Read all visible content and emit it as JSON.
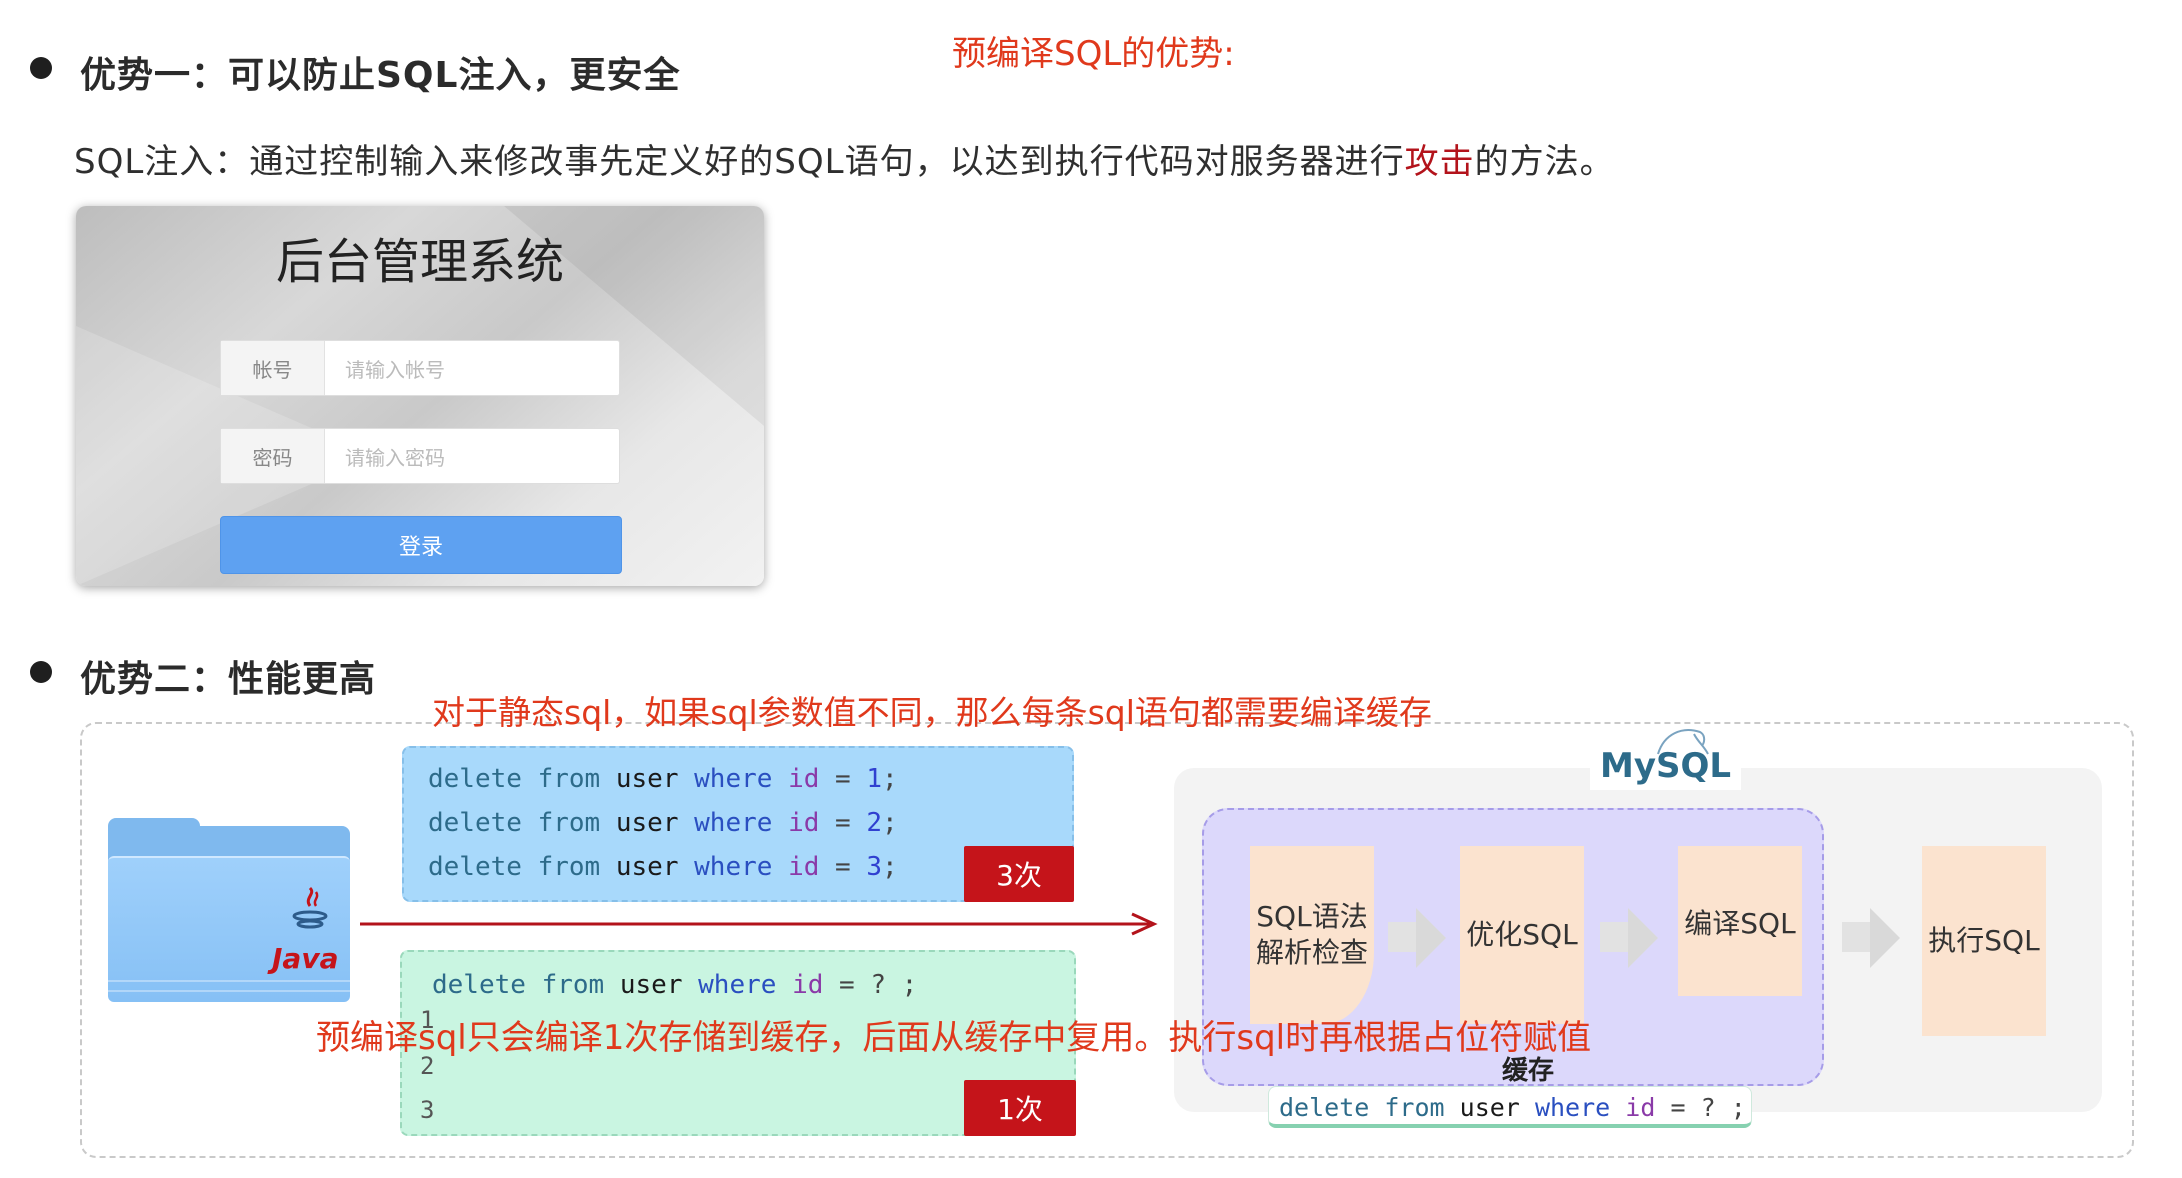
{
  "title_annotation": "预编译SQL的优势:",
  "advantage1": {
    "heading": "优势一：可以防止SQL注入，更安全",
    "desc_before": "SQL注入：通过控制输入来修改事先定义好的SQL语句，以达到执行代码对服务器进行",
    "desc_highlight": "攻击",
    "desc_after": "的方法。"
  },
  "login_mock": {
    "title": "后台管理系统",
    "account_label": "帐号",
    "account_placeholder": "请输入帐号",
    "password_label": "密码",
    "password_placeholder": "请输入密码",
    "login_button": "登录"
  },
  "advantage2": {
    "heading": "优势二：性能更高",
    "static_annotation": "对于静态sql，如果sql参数值不同，那么每条sql语句都需要编译缓存",
    "prepared_annotation": "预编译sql只会编译1次存储到缓存，后面从缓存中复用。执行sql时再根据占位符赋值"
  },
  "static_sql": {
    "lines": [
      {
        "kw1": "delete",
        "kw2": "from",
        "table": "user",
        "kw3": "where",
        "col": "id",
        "op": "=",
        "val": "1",
        "end": ";"
      },
      {
        "kw1": "delete",
        "kw2": "from",
        "table": "user",
        "kw3": "where",
        "col": "id",
        "op": "=",
        "val": "2",
        "end": ";"
      },
      {
        "kw1": "delete",
        "kw2": "from",
        "table": "user",
        "kw3": "where",
        "col": "id",
        "op": "=",
        "val": "3",
        "end": ";"
      }
    ],
    "badge": "3次"
  },
  "prepared_sql": {
    "line": {
      "kw1": "delete",
      "kw2": "from",
      "table": "user",
      "kw3": "where",
      "col": "id",
      "op": "=",
      "val": "?",
      "end": ";"
    },
    "params": [
      "1",
      "2",
      "3"
    ],
    "badge": "1次"
  },
  "java_label": "Java",
  "mysql": {
    "logo": "MySQL",
    "steps": [
      "SQL语法\n解析检查",
      "优化SQL",
      "编译SQL",
      "执行SQL"
    ],
    "cache_label": "缓存",
    "cached_sql": {
      "kw1": "delete",
      "kw2": "from",
      "table": "user",
      "kw3": "where",
      "col": "id",
      "op": "=",
      "val": "?",
      "end": ";"
    }
  },
  "colors": {
    "annotation_red": "#e0391c",
    "badge_red": "#c5141a",
    "static_box_blue": "#a8d9fb",
    "prepared_box_green": "#c9f5e1",
    "purple_cache": "#dcd8fb",
    "step_orange": "#fbe3cf",
    "arrow_red": "#b3131b"
  }
}
